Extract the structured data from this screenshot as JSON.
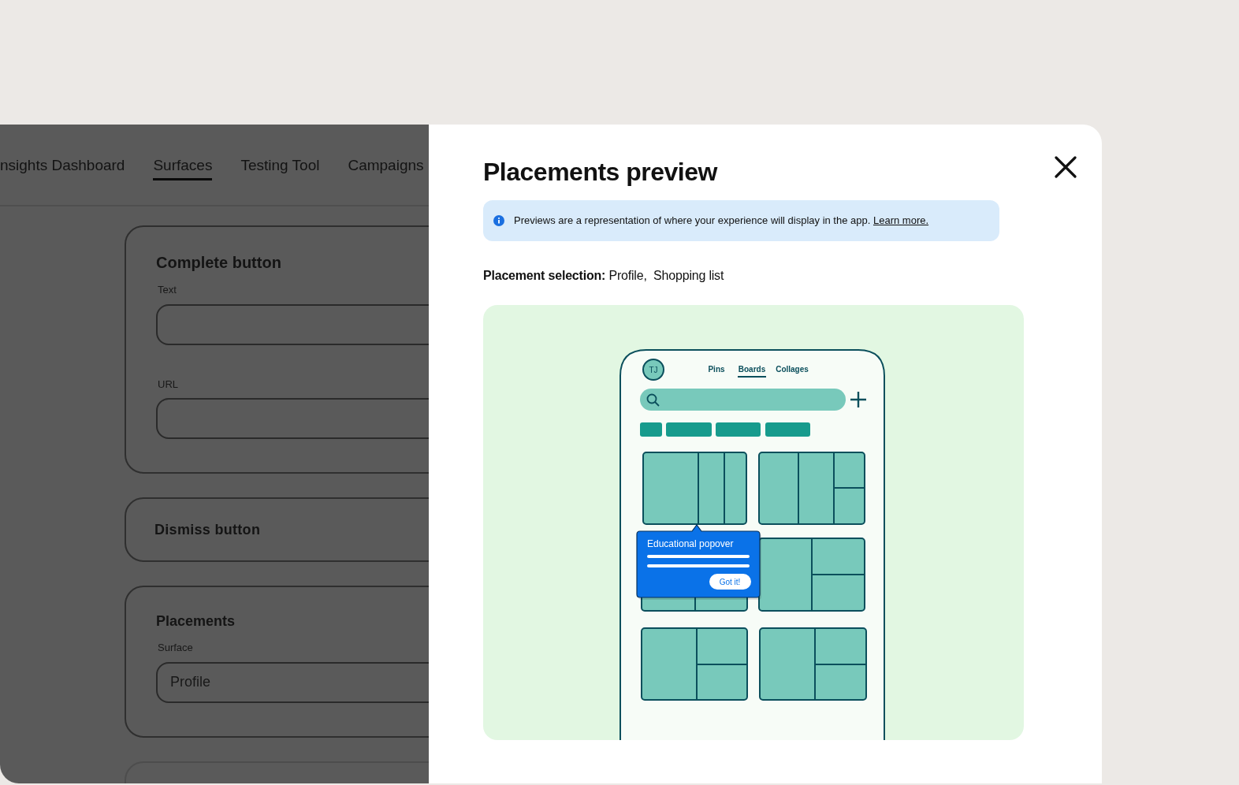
{
  "background_page": {
    "tabs": [
      {
        "label": "nsights Dashboard",
        "selected": false
      },
      {
        "label": "Surfaces",
        "selected": true
      },
      {
        "label": "Testing Tool",
        "selected": false
      },
      {
        "label": "Campaigns",
        "selected": false
      }
    ],
    "cards": [
      {
        "kind": "form",
        "title": "Complete button",
        "fields": [
          {
            "label": "Text"
          },
          {
            "label": "URL"
          }
        ]
      },
      {
        "kind": "collapsed",
        "title": "Dismiss button"
      },
      {
        "kind": "form",
        "title": "Placements",
        "fields": [
          {
            "label": "Surface",
            "value": "Profile"
          }
        ]
      }
    ]
  },
  "modal": {
    "title": "Placements preview",
    "banner": {
      "text": "Previews are a representation of where your experience will display in the app.",
      "link": "Learn more."
    },
    "selection": {
      "label": "Placement selection:",
      "values": [
        "Profile,",
        "Shopping list"
      ]
    },
    "mockup": {
      "avatar": "TJ",
      "tabs": [
        {
          "label": "Pins",
          "selected": false
        },
        {
          "label": "Boards",
          "selected": true
        },
        {
          "label": "Collages",
          "selected": false
        }
      ],
      "popover": {
        "title": "Educational popover",
        "button": "Got it!"
      }
    }
  }
}
